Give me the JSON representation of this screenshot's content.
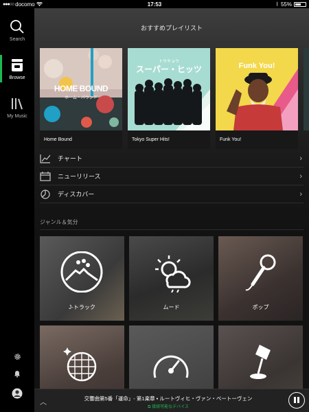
{
  "status_bar": {
    "carrier": "docomo",
    "time": "17:53",
    "battery": "55%",
    "battery_level": 0.55
  },
  "sidebar": {
    "items": [
      {
        "label": "Search",
        "icon": "search-icon"
      },
      {
        "label": "Browse",
        "icon": "browse-icon"
      },
      {
        "label": "My Music",
        "icon": "library-icon"
      }
    ],
    "accent": "#1db954"
  },
  "featured": {
    "title": "おすすめプレイリスト",
    "playlists": [
      {
        "label": "Home Bound",
        "cover_title": "HOME BOUND",
        "cover_subtitle": "ホーム・バウンド"
      },
      {
        "label": "Tokyo Super Hits!",
        "cover_title": "スーパー・ヒッツ",
        "cover_subtitle": "トウキョウ"
      },
      {
        "label": "Funk You!",
        "cover_title": "Funk You!"
      }
    ]
  },
  "menu": {
    "items": [
      {
        "label": "チャート",
        "icon": "chart-icon"
      },
      {
        "label": "ニューリリース",
        "icon": "calendar-icon"
      },
      {
        "label": "ディスカバー",
        "icon": "discover-icon"
      }
    ]
  },
  "genres": {
    "title": "ジャンル＆気分",
    "tiles": [
      {
        "label": "J-トラック",
        "icon": "mount-fuji-icon"
      },
      {
        "label": "ムード",
        "icon": "sun-cloud-icon"
      },
      {
        "label": "ポップ",
        "icon": "microphone-icon"
      },
      {
        "label": "",
        "icon": "disco-ball-icon"
      },
      {
        "label": "",
        "icon": "speedometer-icon"
      },
      {
        "label": "",
        "icon": "lamp-icon"
      }
    ]
  },
  "player": {
    "track": "交響曲第5番「運命」- 第1楽章 • ルートヴィヒ・ヴァン・ベートーヴェン",
    "device": "接続可能なデバイス"
  }
}
